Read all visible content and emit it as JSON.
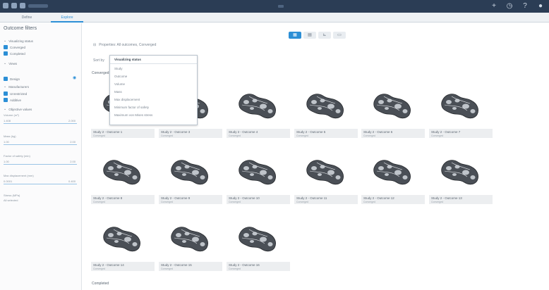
{
  "tabs": [
    {
      "label": "Define"
    },
    {
      "label": "Explore"
    }
  ],
  "sidebar": {
    "title": "Outcome filters",
    "sections": [
      {
        "label": "Visualizing status",
        "items": [
          "Converged",
          "Completed"
        ]
      },
      {
        "label": "Views",
        "items": [
          "Design"
        ]
      },
      {
        "label": "Manufacturers",
        "items": [
          "Unrestricted",
          "Additive"
        ]
      },
      {
        "label": "Objective values"
      }
    ],
    "fields": [
      {
        "label": "Volume (m³)",
        "value": "1.408",
        "range": "2.000"
      },
      {
        "label": "Mass (kg)",
        "value": "1.00",
        "range": "2.00"
      },
      {
        "label": "Factor of safety (min)",
        "value": "1.00",
        "range": "2.00"
      },
      {
        "label": "Max displacement (mm)",
        "value": "0.0001",
        "range": "0.400"
      },
      {
        "label": "Stress (MPa)",
        "value": "All selected",
        "range": ""
      }
    ]
  },
  "toolbar": {
    "filter_text": "Properties: All outcomes, Converged",
    "sort_label": "Sort by",
    "view_icons": [
      "grid-icon",
      "table-icon",
      "chart-icon",
      "list-icon"
    ]
  },
  "dropdown": {
    "items": [
      "Visualizing status",
      "Study",
      "Outcome",
      "Volume",
      "Mass",
      "Max displacement",
      "Minimum factor of safety",
      "Maximum von Mises stress"
    ]
  },
  "status_header": "Converged",
  "status_footer": "Completed",
  "outcomes": [
    {
      "title": "Study 2 - Outcome 1",
      "status": "Converged"
    },
    {
      "title": "Study 2 - Outcome 3",
      "status": "Converged"
    },
    {
      "title": "Study 2 - Outcome 4",
      "status": "Converged"
    },
    {
      "title": "Study 2 - Outcome 5",
      "status": "Converged"
    },
    {
      "title": "Study 2 - Outcome 6",
      "status": "Converged"
    },
    {
      "title": "Study 2 - Outcome 7",
      "status": "Converged"
    },
    {
      "title": "Study 2 - Outcome 8",
      "status": "Converged"
    },
    {
      "title": "Study 2 - Outcome 9",
      "status": "Converged"
    },
    {
      "title": "Study 2 - Outcome 10",
      "status": "Converged"
    },
    {
      "title": "Study 2 - Outcome 11",
      "status": "Converged"
    },
    {
      "title": "Study 2 - Outcome 12",
      "status": "Converged"
    },
    {
      "title": "Study 2 - Outcome 13",
      "status": "Converged"
    },
    {
      "title": "Study 2 - Outcome 14",
      "status": "Converged"
    },
    {
      "title": "Study 2 - Outcome 15",
      "status": "Converged"
    },
    {
      "title": "Study 2 - Outcome 16",
      "status": "Converged"
    }
  ],
  "colors": {
    "accent": "#2c8fd6",
    "titlebar": "#2b3d55",
    "caption_bg": "#eceef0"
  }
}
